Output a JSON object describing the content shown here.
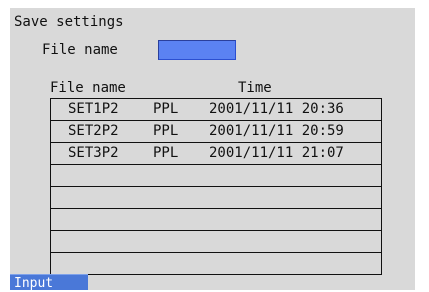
{
  "screen": {
    "title": "Save settings"
  },
  "filename_field": {
    "label": "File name",
    "value": "",
    "color": "#5b82f2"
  },
  "table": {
    "columns": [
      "File name",
      "Time"
    ],
    "rows": [
      {
        "name": "SET1P2",
        "type": "PPL",
        "time": "2001/11/11 20:36"
      },
      {
        "name": "SET2P2",
        "type": "PPL",
        "time": "2001/11/11 20:59"
      },
      {
        "name": "SET3P2",
        "type": "PPL",
        "time": "2001/11/11 21:07"
      },
      {
        "name": "",
        "type": "",
        "time": ""
      },
      {
        "name": "",
        "type": "",
        "time": ""
      },
      {
        "name": "",
        "type": "",
        "time": ""
      },
      {
        "name": "",
        "type": "",
        "time": ""
      },
      {
        "name": "",
        "type": "",
        "time": ""
      }
    ]
  },
  "softkeys": {
    "input_label": "Input",
    "color": "#4a78d8"
  }
}
